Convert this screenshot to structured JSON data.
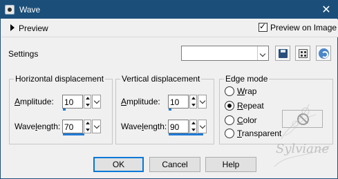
{
  "window": {
    "title": "Wave",
    "close_glyph": "✕",
    "icon": "wave-app-icon"
  },
  "preview": {
    "label": "Preview",
    "on_image_label": "Preview on Image",
    "on_image_checked": true
  },
  "settings": {
    "label": "Settings",
    "value": ""
  },
  "toolbar": {
    "save_icon": "save-icon",
    "random_icon": "randomize-icon",
    "reset_icon": "reset-icon"
  },
  "horizontal": {
    "legend": "Horizontal displacement",
    "amplitude": {
      "label_u": "A",
      "label_rest": "mplitude:",
      "value": "10",
      "level": 0.1
    },
    "wavelength": {
      "label_before": "Wave",
      "label_u": "l",
      "label_rest": "ength:",
      "value": "70",
      "level": 0.7
    }
  },
  "vertical": {
    "legend": "Vertical displacement",
    "amplitude": {
      "label_u": "A",
      "label_rest": "mplitude:",
      "value": "10",
      "level": 0.1
    },
    "wavelength": {
      "label_before": "Wave",
      "label_u": "l",
      "label_rest": "ength:",
      "value": "90",
      "level": 0.9
    }
  },
  "edge_mode": {
    "legend": "Edge mode",
    "options": [
      {
        "u": "W",
        "rest": "rap",
        "selected": false
      },
      {
        "u": "R",
        "rest": "epeat",
        "selected": true
      },
      {
        "u": "C",
        "rest": "olor",
        "selected": false
      },
      {
        "u": "T",
        "rest": "ransparent",
        "selected": false
      }
    ]
  },
  "watermark": {
    "text": "Sylviane"
  },
  "buttons": {
    "ok": "OK",
    "cancel": "Cancel",
    "help": "Help"
  },
  "colors": {
    "titlebar": "#1b4f7a",
    "progress": "#1f7ad6",
    "default_button_border": "#0078d7"
  }
}
